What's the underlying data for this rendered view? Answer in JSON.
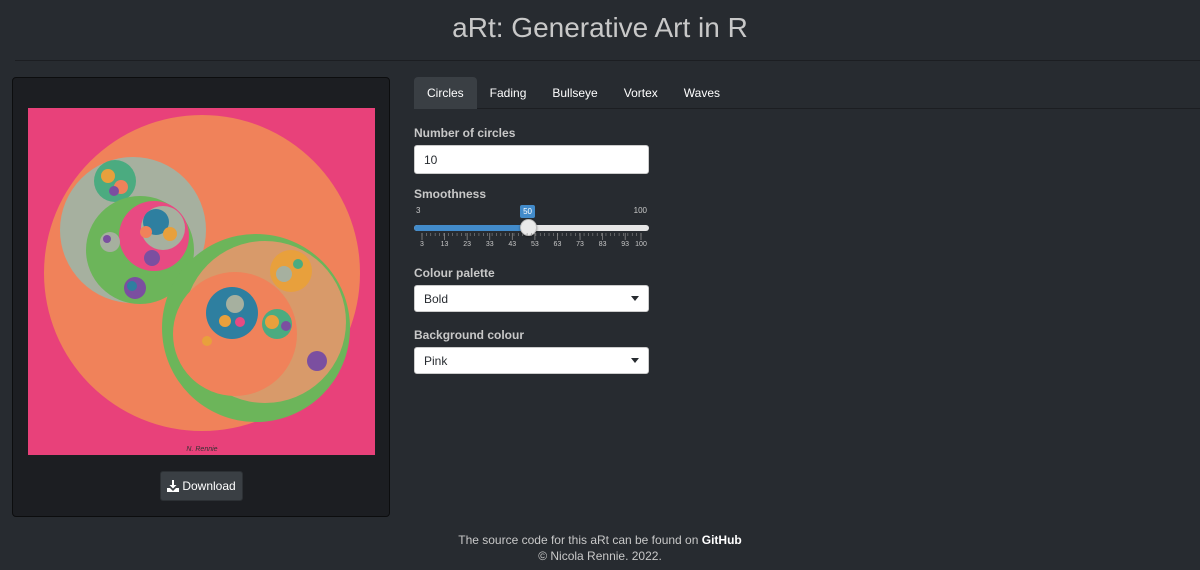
{
  "header": {
    "title": "aRt: Generative Art in R"
  },
  "art": {
    "background": "#e8417a",
    "signature": "N. Rennie",
    "palette_colors": [
      "#f0825a",
      "#a6b09f",
      "#6cb55a",
      "#4bab80",
      "#2e7fa0",
      "#e8a03c",
      "#7b4fa0",
      "#e84a82"
    ]
  },
  "download": {
    "label": "Download",
    "icon": "download-icon"
  },
  "tabs": [
    {
      "label": "Circles",
      "active": true
    },
    {
      "label": "Fading",
      "active": false
    },
    {
      "label": "Bullseye",
      "active": false
    },
    {
      "label": "Vortex",
      "active": false
    },
    {
      "label": "Waves",
      "active": false
    }
  ],
  "controls": {
    "num_circles": {
      "label": "Number of circles",
      "value": "10"
    },
    "smoothness": {
      "label": "Smoothness",
      "min": "3",
      "max": "100",
      "value": "50",
      "grid": [
        "3",
        "13",
        "23",
        "33",
        "43",
        "53",
        "63",
        "73",
        "83",
        "93",
        "100"
      ]
    },
    "palette": {
      "label": "Colour palette",
      "value": "Bold"
    },
    "background": {
      "label": "Background colour",
      "value": "Pink"
    }
  },
  "footer": {
    "text": "The source code for this aRt can be found on",
    "link": "GitHub",
    "copyright": "© Nicola Rennie. 2022."
  },
  "colors": {
    "accent": "#428bca",
    "page_bg": "#272b30",
    "panel_bg": "#1c1e22"
  }
}
